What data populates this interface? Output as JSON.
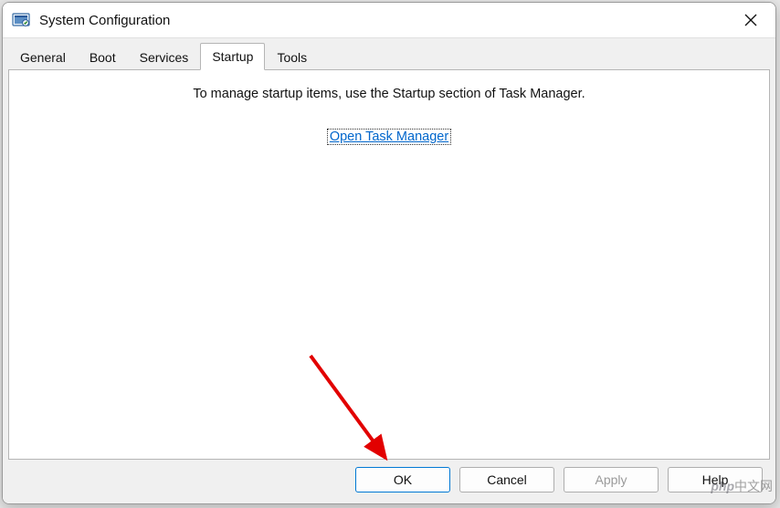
{
  "window": {
    "title": "System Configuration"
  },
  "tabs": {
    "general": "General",
    "boot": "Boot",
    "services": "Services",
    "startup": "Startup",
    "tools": "Tools"
  },
  "startup_panel": {
    "info_text": "To manage startup items, use the Startup section of Task Manager.",
    "link_text": "Open Task Manager"
  },
  "buttons": {
    "ok": "OK",
    "cancel": "Cancel",
    "apply": "Apply",
    "help": "Help"
  },
  "watermark": {
    "left": "php",
    "right": "中文网"
  }
}
